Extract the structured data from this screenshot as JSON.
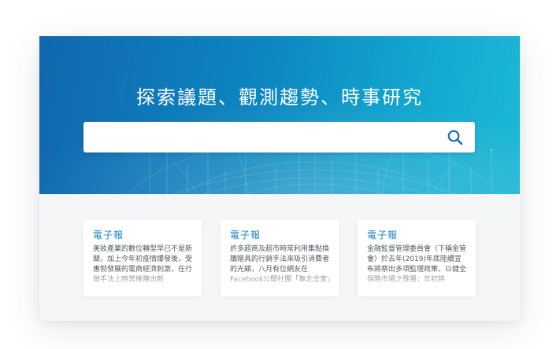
{
  "hero": {
    "title": "探索議題、觀測趨勢、時事研究"
  },
  "search": {
    "value": "",
    "placeholder": "",
    "button_icon": "search-icon"
  },
  "cards": [
    {
      "tag": "電子報",
      "excerpt": "美妝產業的數位轉型早已不是新聞，加上今年初疫情爆發後，受惠勃發展的電商經濟刺激，在行銷手法上時常推陳出新"
    },
    {
      "tag": "電子報",
      "excerpt": "許多超商及超市時常利用集點換購贈具的行銷手法來吸引消費者的光顧，八月有位網友在Facebook公開社團「靠北全家」"
    },
    {
      "tag": "電子報",
      "excerpt": "金融監督管理委員會（下稱金管會）於去年(2019)年底陸續宣布將祭出多項監理政策，以健全保險市場之發展；年初將"
    }
  ],
  "colors": {
    "hero_start": "#1167ae",
    "hero_end": "#1db8d6",
    "accent": "#1a84c0",
    "search_icon": "#1b6fa8"
  }
}
